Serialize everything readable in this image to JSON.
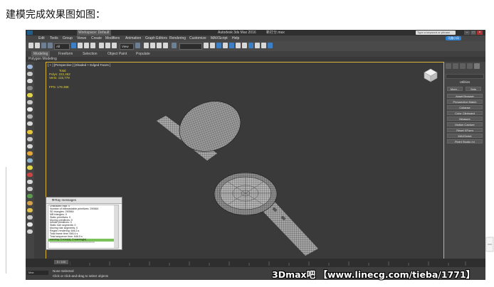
{
  "caption": "建模完成效果图如图：",
  "window": {
    "workspace": "Workspace: Default",
    "title": "Autodesk 3ds Max 2016",
    "filename": "新打分.max",
    "search_placeholder": "Type a keyword or phrase",
    "login": "马路小风"
  },
  "menu": [
    "Edit",
    "Tools",
    "Group",
    "Views",
    "Create",
    "Modifiers",
    "Animation",
    "Graph Editors",
    "Rendering",
    "Customize",
    "MAXScript",
    "Help"
  ],
  "toolbar": {
    "selection_filter": "All",
    "view_dropdown": "View"
  },
  "ribbon": {
    "tabs": [
      "Modeling",
      "Freeform",
      "Selection",
      "Object Paint",
      "Populate"
    ],
    "active": "Modeling",
    "subtitle": "Polygon Modeling"
  },
  "viewport": {
    "label": "[ + ] [Perspective ] [Shaded + Edged Faces ]",
    "stats": {
      "header": "Total",
      "polys_label": "Polys:",
      "polys": "222,462",
      "verts_label": "Verts:",
      "verts": "115,779",
      "fps_label": "FPS:",
      "fps": "178.388"
    }
  },
  "command_panel": {
    "title": "Utilities",
    "more_label": "More...",
    "sets_label": "Sets",
    "buttons": [
      "Asset Browser",
      "Perspective Match",
      "Collapse",
      "Color Clipboard",
      "Measure",
      "Motion Capture",
      "Reset XForm",
      "MAXScript",
      "Flight Studio (c)"
    ]
  },
  "vray": {
    "title": "V-Ray messages",
    "lines": [
      "Unshaded rays: 0",
      "Number of intersectable primitives: 290564",
      "  SD triangles: 290564",
      "  MB triangles: 0",
      "  Static primitives: 0",
      "  Moving primitives: 0",
      "  Infinite primitives: 0",
      "  Static hair segments: 0",
      "  Moving hair segments: 0",
      "Region rendering: 646.3 s",
      "Total frame time: 646.4 s",
      "Total sequence time: 646.5 s"
    ],
    "highlight": "warning: 0 error(s), 0 warning(s)",
    "separator": "=============================="
  },
  "timeline": {
    "frame_counter": "0 / 100"
  },
  "status": {
    "selection": "None Selected",
    "prompt": "Click or click-and-drag to select objects",
    "maxscript_label": "Max"
  },
  "watermark": "3Dmax吧 【www.linecg.com/tieba/1771】",
  "colors": {
    "viewport_border": "#d9b53a",
    "stats_text": "#e6d53a",
    "vray_highlight": "#7cc25a"
  }
}
